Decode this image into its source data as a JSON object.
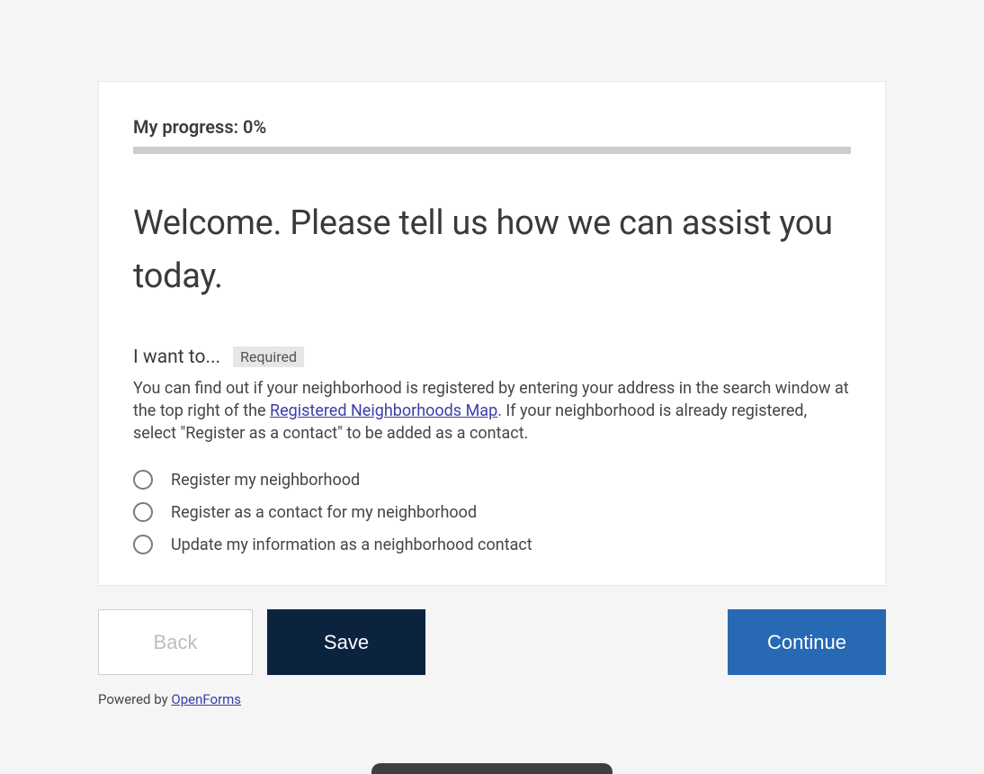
{
  "progress": {
    "label": "My progress: 0%"
  },
  "heading": "Welcome. Please tell us how we can assist you today.",
  "question": {
    "label": "I want to...",
    "required_badge": "Required",
    "help_text_1": "You can find out if your neighborhood is registered by entering your address in the search window at the top right of the ",
    "help_link_text": "Registered Neighborhoods Map",
    "help_text_2": ". If your neighborhood is already registered, select \"Register as a contact\" to be added as a contact.",
    "options": [
      "Register my neighborhood",
      "Register as a contact for my neighborhood",
      "Update my information as a neighborhood contact"
    ]
  },
  "buttons": {
    "back": "Back",
    "save": "Save",
    "continue": "Continue"
  },
  "footer": {
    "prefix": "Powered by ",
    "link_text": "OpenForms"
  }
}
